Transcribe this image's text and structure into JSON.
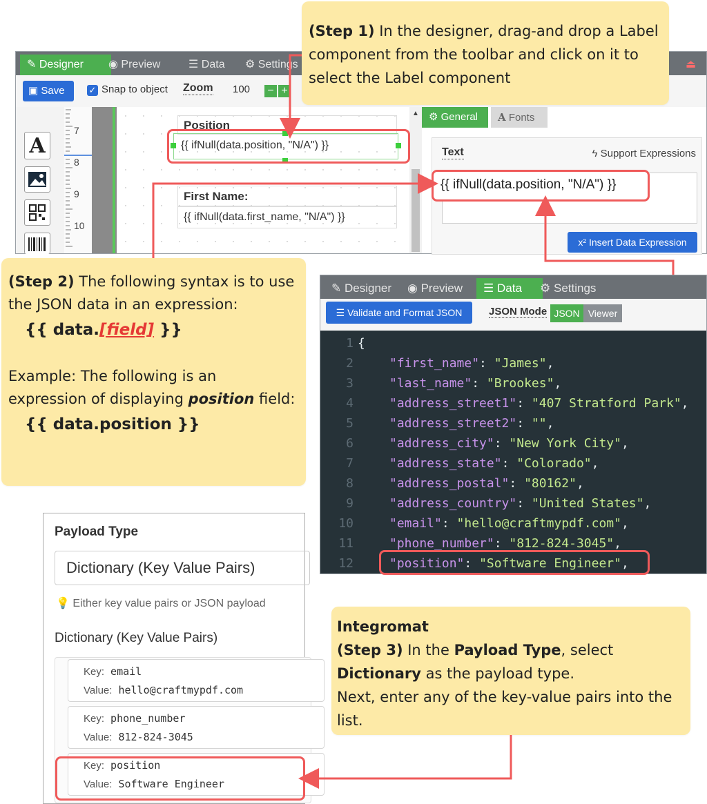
{
  "step1": {
    "lead": "(Step 1)",
    "text": " In the designer, drag-and drop a Label component from the toolbar and click on it to select the Label component"
  },
  "designer": {
    "tabs": [
      "Designer",
      "Preview",
      "Data",
      "Settings"
    ],
    "save_label": "Save",
    "snap_label": "Snap to object",
    "zoom_label": "Zoom",
    "zoom_value": "100",
    "ruler_numbers": [
      "7",
      "8",
      "9",
      "10"
    ],
    "canvas": {
      "position_label": "Position",
      "position_expr": "{{ ifNull(data.position, \"N/A\") }}",
      "firstname_label": "First Name:",
      "firstname_expr": "{{ ifNull(data.first_name, \"N/A\") }}"
    },
    "panel": {
      "tab_general": "General",
      "tab_fonts": "Fonts",
      "text_label": "Text",
      "support_expr": "Support Expressions",
      "text_value": "{{ ifNull(data.position, \"N/A\") }}",
      "insert_button": "Insert Data Expression"
    }
  },
  "step2": {
    "lead": "(Step 2)",
    "text1": "  The following syntax is to use the JSON data in an expression:",
    "syntax_prefix": "{{ data.",
    "syntax_field": "[field]",
    "syntax_suffix": " }}",
    "example_text": "Example: The following is an expression of displaying ",
    "example_field": "position",
    "example_tail": " field:",
    "example_expr": "{{ data.position }}"
  },
  "datawin": {
    "tabs": [
      "Designer",
      "Preview",
      "Data",
      "Settings"
    ],
    "validate_button": "Validate and Format JSON",
    "json_mode_label": "JSON Mode",
    "toggle_json": "JSON",
    "toggle_viewer": "Viewer",
    "lines": [
      {
        "n": "1",
        "key": "",
        "val": "",
        "raw": "{"
      },
      {
        "n": "2",
        "key": "\"first_name\"",
        "val": "\"James\"",
        "raw": ""
      },
      {
        "n": "3",
        "key": "\"last_name\"",
        "val": "\"Brookes\"",
        "raw": ""
      },
      {
        "n": "4",
        "key": "\"address_street1\"",
        "val": "\"407 Stratford Park\"",
        "raw": ""
      },
      {
        "n": "5",
        "key": "\"address_street2\"",
        "val": "\"\"",
        "raw": ""
      },
      {
        "n": "6",
        "key": "\"address_city\"",
        "val": "\"New York City\"",
        "raw": ""
      },
      {
        "n": "7",
        "key": "\"address_state\"",
        "val": "\"Colorado\"",
        "raw": ""
      },
      {
        "n": "8",
        "key": "\"address_postal\"",
        "val": "\"80162\"",
        "raw": ""
      },
      {
        "n": "9",
        "key": "\"address_country\"",
        "val": "\"United States\"",
        "raw": ""
      },
      {
        "n": "10",
        "key": "\"email\"",
        "val": "\"hello@craftmypdf.com\"",
        "raw": ""
      },
      {
        "n": "11",
        "key": "\"phone_number\"",
        "val": "\"812-824-3045\"",
        "raw": ""
      },
      {
        "n": "12",
        "key": "\"position\"",
        "val": "\"Software Engineer\"",
        "raw": ""
      }
    ]
  },
  "payload": {
    "title": "Payload Type",
    "select_value": "Dictionary (Key Value Pairs)",
    "hint": "Either key value pairs or JSON payload",
    "section_label": "Dictionary (Key Value Pairs)",
    "key_label": "Key:",
    "value_label": "Value:",
    "items": [
      {
        "key": "email",
        "value": "hello@craftmypdf.com"
      },
      {
        "key": "phone_number",
        "value": "812-824-3045"
      },
      {
        "key": "position",
        "value": "Software Engineer"
      }
    ]
  },
  "step3": {
    "title": "Integromat",
    "lead": "(Step 3)",
    "text_a": " In the ",
    "bold_a": "Payload Type",
    "text_b": ", select ",
    "bold_b": "Dictionary",
    "text_c": " as the payload type.",
    "text_d": "Next, enter any of the key-value pairs into the list."
  },
  "colors": {
    "callout": "#fdeaa7",
    "highlight": "#ef5a5a",
    "active_tab": "#4caf50",
    "primary_button": "#2b6cd6"
  }
}
